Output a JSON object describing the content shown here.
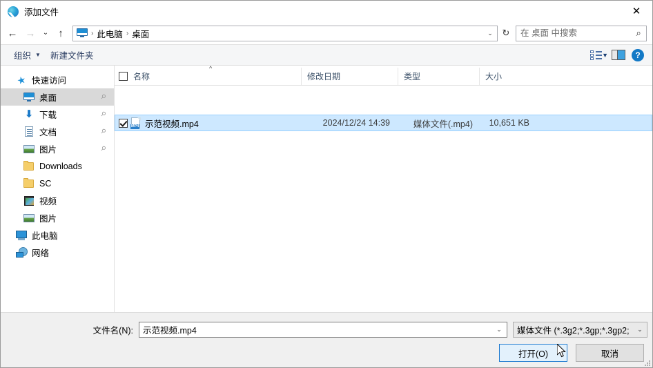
{
  "window": {
    "title": "添加文件",
    "app_icon": "swirl-icon",
    "close_label": "✕"
  },
  "nav": {
    "back": "←",
    "forward": "→",
    "history": "⌄",
    "up": "↑",
    "refresh": "↻",
    "breadcrumb": {
      "icon": "monitor-icon",
      "items": [
        "此电脑",
        "桌面"
      ],
      "separator": "›"
    },
    "address_chevron": "⌄"
  },
  "search": {
    "placeholder": "在 桌面 中搜索",
    "value": "",
    "icon": "search-icon"
  },
  "toolbar": {
    "organize_label": "组织",
    "organize_caret": "▼",
    "new_folder_label": "新建文件夹",
    "view_icon": "view-layout-icon",
    "view_caret": "▼",
    "preview_pane_icon": "preview-pane-icon",
    "help_label": "?"
  },
  "sidebar": {
    "items": [
      {
        "label": "快速访问",
        "icon": "star-icon",
        "indent": false,
        "selected": false,
        "pinned": false
      },
      {
        "label": "桌面",
        "icon": "monitor-icon",
        "indent": true,
        "selected": true,
        "pinned": true
      },
      {
        "label": "下载",
        "icon": "download-icon",
        "indent": true,
        "selected": false,
        "pinned": true
      },
      {
        "label": "文档",
        "icon": "document-icon",
        "indent": true,
        "selected": false,
        "pinned": true
      },
      {
        "label": "图片",
        "icon": "picture-icon",
        "indent": true,
        "selected": false,
        "pinned": true
      },
      {
        "label": "Downloads",
        "icon": "folder-icon",
        "indent": true,
        "selected": false,
        "pinned": false
      },
      {
        "label": "SC",
        "icon": "folder-icon",
        "indent": true,
        "selected": false,
        "pinned": false
      },
      {
        "label": "视频",
        "icon": "video-icon",
        "indent": true,
        "selected": false,
        "pinned": false
      },
      {
        "label": "图片",
        "icon": "picture-icon",
        "indent": true,
        "selected": false,
        "pinned": false
      },
      {
        "label": "此电脑",
        "icon": "this-pc-icon",
        "indent": false,
        "selected": false,
        "pinned": false
      },
      {
        "label": "网络",
        "icon": "network-icon",
        "indent": false,
        "selected": false,
        "pinned": false
      }
    ]
  },
  "filelist": {
    "columns": [
      "名称",
      "修改日期",
      "类型",
      "大小"
    ],
    "sort_caret": "^",
    "header_checkbox_checked": false,
    "rows": [
      {
        "name": "示范视频.mp4",
        "modified": "2024/12/24 14:39",
        "type": "媒体文件(.mp4)",
        "size": "10,651 KB",
        "icon": "mp4-file-icon",
        "icon_tag": "MP4",
        "checked": true,
        "selected": true
      }
    ]
  },
  "footer": {
    "filename_label": "文件名(N):",
    "filename_value": "示范视频.mp4",
    "filename_chevron": "⌄",
    "filter_value": "媒体文件 (*.3g2;*.3gp;*.3gp2;",
    "filter_chevron": "⌄",
    "open_label": "打开(O)",
    "cancel_label": "取消"
  },
  "colors": {
    "accent": "#1e7ad0",
    "selection": "#cde8ff",
    "sidebar_selection": "#d9d9d9",
    "toolbar_bg": "#f5f6f7",
    "footer_bg": "#f0f0f0",
    "help_blue": "#1279c6"
  }
}
